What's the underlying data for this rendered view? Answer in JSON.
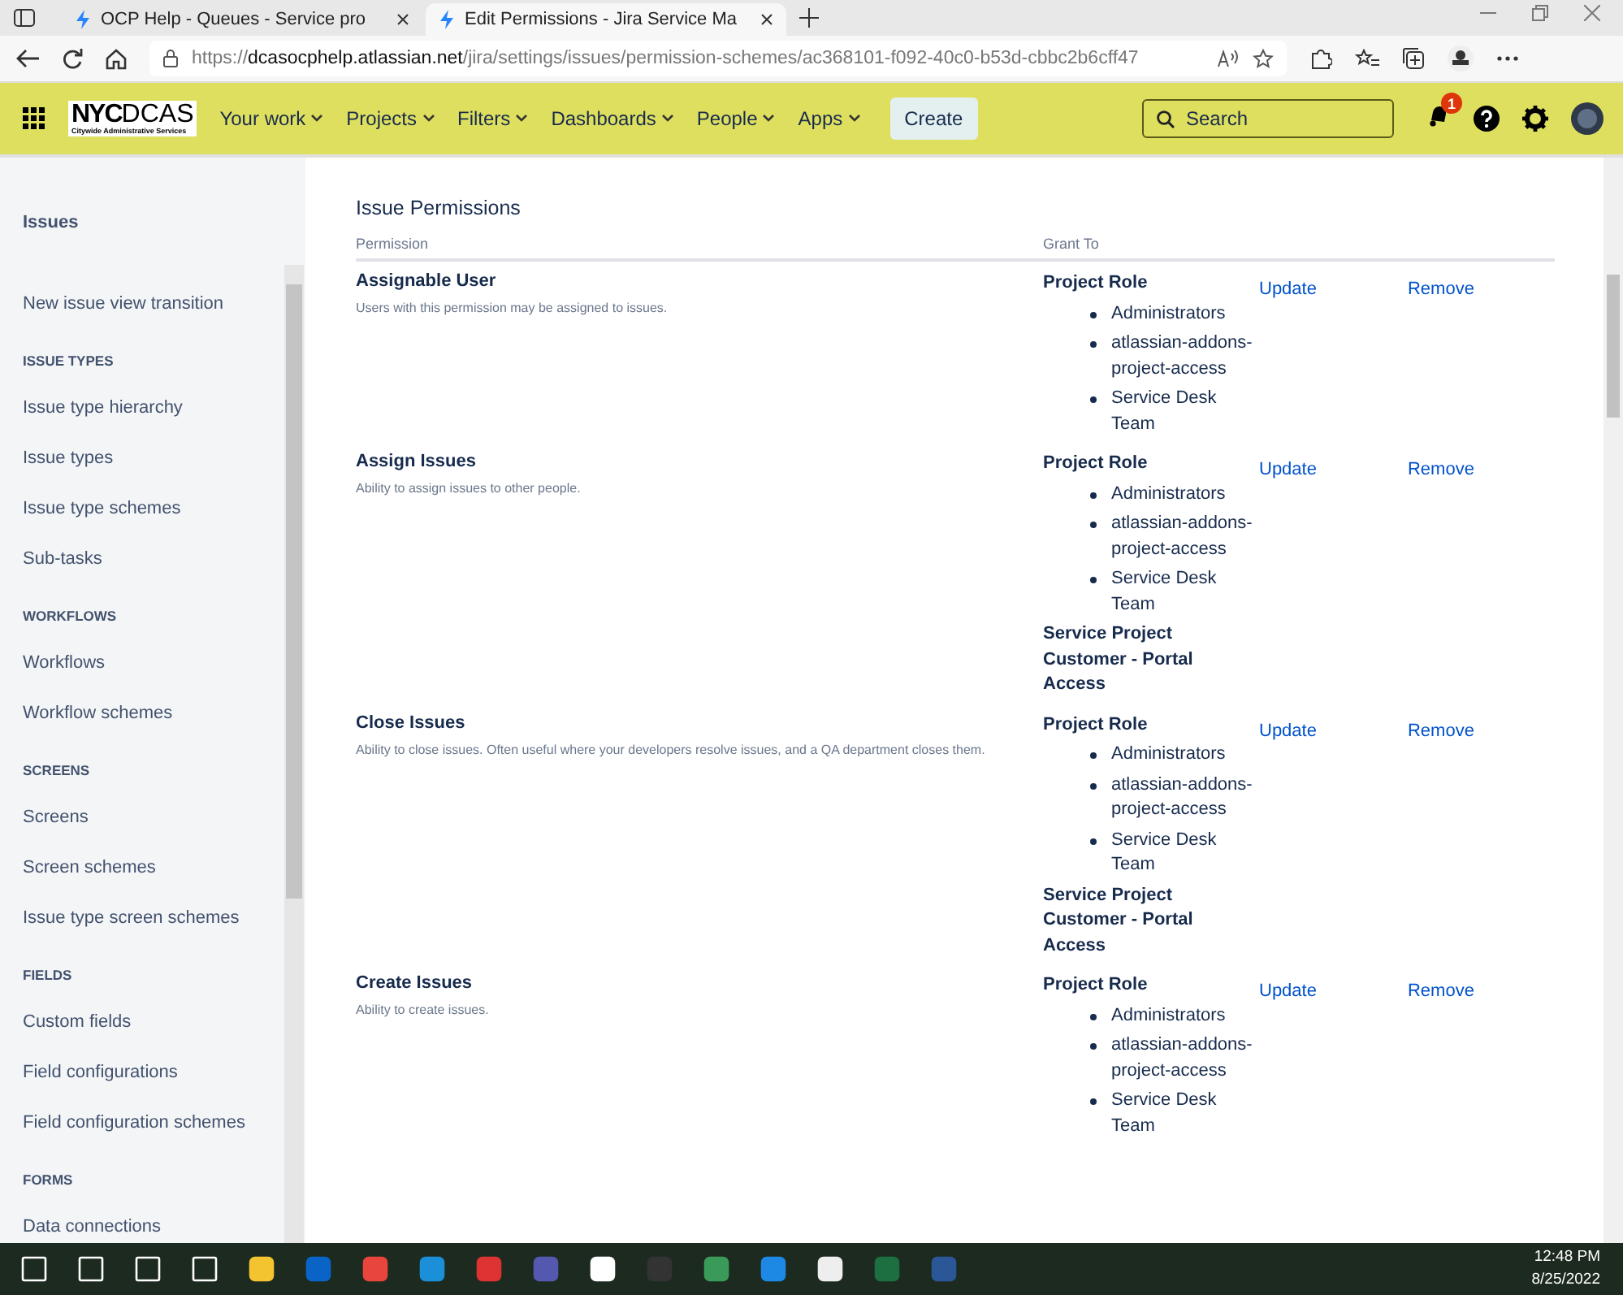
{
  "browser": {
    "tabs": [
      {
        "title": "OCP Help - Queues - Service pro",
        "selected": false
      },
      {
        "title": "Edit Permissions - Jira Service Ma",
        "selected": true
      }
    ],
    "url": {
      "scheme": "https://",
      "host": "dcasocphelp.atlassian.net",
      "path": "/jira/settings/issues/permission-schemes/ac368101-f092-40c0-b53d-cbbc2b6cff47"
    }
  },
  "nav": {
    "logo": {
      "big": "NYC",
      "light": "DCAS",
      "sub": "Citywide Administrative Services"
    },
    "items": [
      "Your work",
      "Projects",
      "Filters",
      "Dashboards",
      "People",
      "Apps"
    ],
    "create": "Create",
    "search": {
      "placeholder": "Search"
    },
    "notifications": "1"
  },
  "sidebar": {
    "title": "Issues",
    "items": [
      {
        "kind": "link",
        "label": "New issue view transition"
      },
      {
        "kind": "heading",
        "label": "ISSUE TYPES"
      },
      {
        "kind": "link",
        "label": "Issue type hierarchy"
      },
      {
        "kind": "link",
        "label": "Issue types"
      },
      {
        "kind": "link",
        "label": "Issue type schemes"
      },
      {
        "kind": "link",
        "label": "Sub-tasks"
      },
      {
        "kind": "heading",
        "label": "WORKFLOWS"
      },
      {
        "kind": "link",
        "label": "Workflows"
      },
      {
        "kind": "link",
        "label": "Workflow schemes"
      },
      {
        "kind": "heading",
        "label": "SCREENS"
      },
      {
        "kind": "link",
        "label": "Screens"
      },
      {
        "kind": "link",
        "label": "Screen schemes"
      },
      {
        "kind": "link",
        "label": "Issue type screen schemes"
      },
      {
        "kind": "heading",
        "label": "FIELDS"
      },
      {
        "kind": "link",
        "label": "Custom fields"
      },
      {
        "kind": "link",
        "label": "Field configurations"
      },
      {
        "kind": "link",
        "label": "Field configuration schemes"
      },
      {
        "kind": "heading",
        "label": "FORMS"
      },
      {
        "kind": "link",
        "label": "Data connections"
      }
    ]
  },
  "section": {
    "title": "Issue Permissions",
    "columns": [
      "Permission",
      "Grant To"
    ],
    "rows": [
      {
        "name": "Assignable User",
        "description": "Users with this permission may be assigned to issues.",
        "grants": [
          {
            "title": "Project Role",
            "members": [
              "Administrators",
              "atlassian-addons-project-access",
              "Service Desk Team"
            ]
          }
        ],
        "actions": [
          "Update",
          "Remove"
        ]
      },
      {
        "name": "Assign Issues",
        "description": "Ability to assign issues to other people.",
        "grants": [
          {
            "title": "Project Role",
            "members": [
              "Administrators",
              "atlassian-addons-project-access",
              "Service Desk Team"
            ]
          },
          {
            "title": "Service Project Customer - Portal Access"
          }
        ],
        "actions": [
          "Update",
          "Remove"
        ]
      },
      {
        "name": "Close Issues",
        "description": "Ability to close issues. Often useful where your developers resolve issues, and a QA department closes them.",
        "grants": [
          {
            "title": "Project Role",
            "members": [
              "Administrators",
              "atlassian-addons-project-access",
              "Service Desk Team"
            ]
          },
          {
            "title": "Service Project Customer - Portal Access"
          }
        ],
        "actions": [
          "Update",
          "Remove"
        ]
      },
      {
        "name": "Create Issues",
        "description": "Ability to create issues.",
        "grants": [
          {
            "title": "Project Role",
            "members": [
              "Administrators",
              "atlassian-addons-project-access",
              "Service Desk Team"
            ]
          }
        ],
        "actions": [
          "Update",
          "Remove"
        ]
      }
    ]
  },
  "taskbar": {
    "time": "12:48 PM",
    "date": "8/25/2022"
  }
}
